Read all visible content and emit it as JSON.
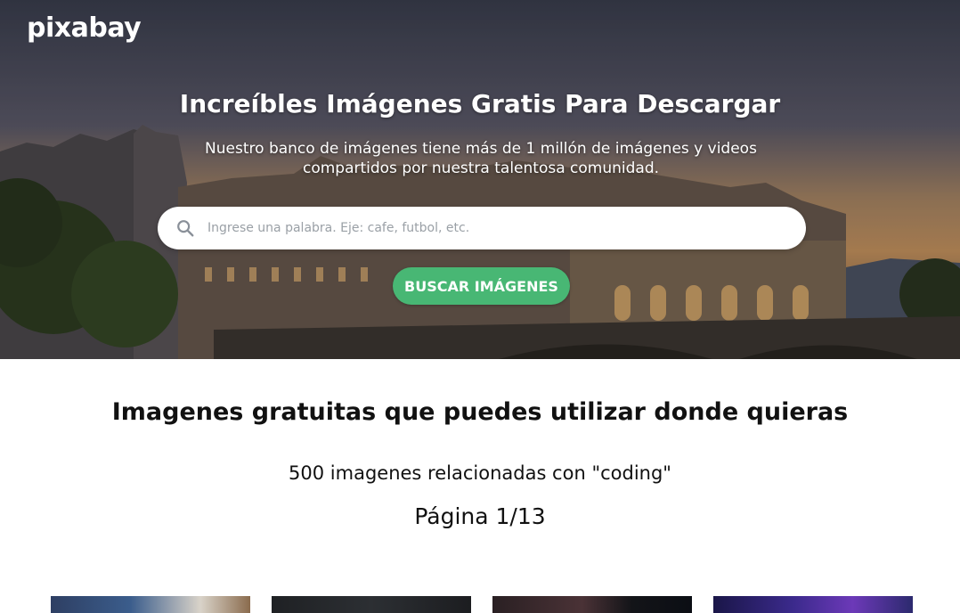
{
  "brand": {
    "logo_text": "pixabay"
  },
  "hero": {
    "title": "Increíbles Imágenes Gratis Para Descargar",
    "subtitle": "Nuestro banco de imágenes tiene más de 1 millón de imágenes y videos compartidos por nuestra talentosa comunidad."
  },
  "search": {
    "placeholder": "Ingrese una palabra. Eje: cafe, futbol, etc.",
    "value": "",
    "icon": "search-icon",
    "button_label": "BUSCAR IMÁGENES"
  },
  "results": {
    "section_title": "Imagenes gratuitas que puedes utilizar donde quieras",
    "count_text": "500 imagenes relacionadas con \"coding\"",
    "page_text": "Página 1/13"
  },
  "colors": {
    "accent_green": "#48b774",
    "text_dark": "#111111",
    "background": "#ffffff"
  }
}
